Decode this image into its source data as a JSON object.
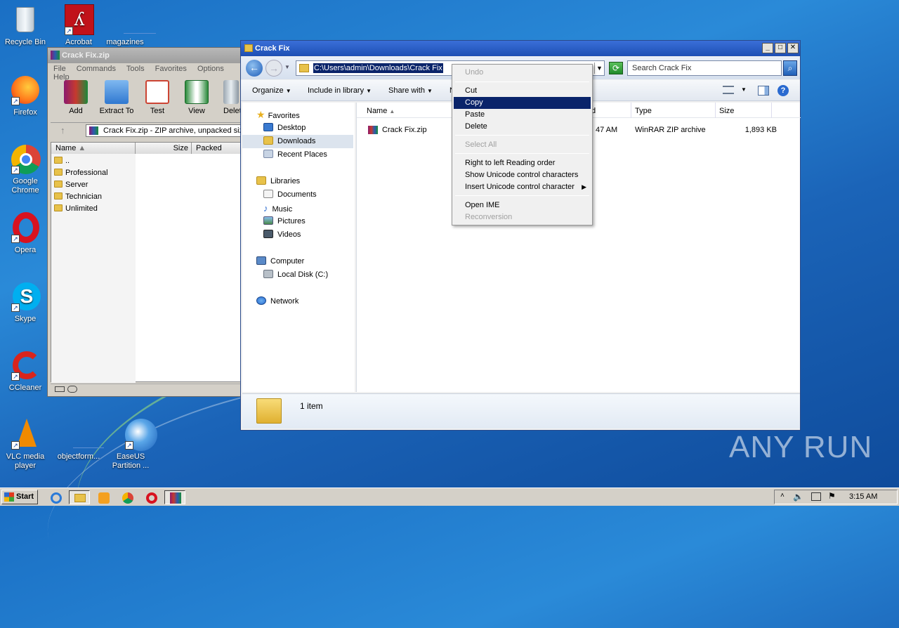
{
  "desktop": {
    "icons": [
      {
        "label": "Recycle Bin",
        "icon": "recycle-bin-icon"
      },
      {
        "label": "Acrobat",
        "icon": "acrobat-icon"
      },
      {
        "label": "magazines",
        "icon": "file-icon"
      },
      {
        "label": "Firefox",
        "icon": "firefox-icon"
      },
      {
        "label": "Google Chrome",
        "icon": "chrome-icon"
      },
      {
        "label": "Opera",
        "icon": "opera-icon"
      },
      {
        "label": "Skype",
        "icon": "skype-icon"
      },
      {
        "label": "CCleaner",
        "icon": "ccleaner-icon"
      },
      {
        "label": "VLC media player",
        "icon": "vlc-icon"
      },
      {
        "label": "objectform...",
        "icon": "file-icon"
      },
      {
        "label": "EaseUS Partition ...",
        "icon": "easeus-icon"
      }
    ],
    "watermark": "ANY RUN"
  },
  "winrar": {
    "title": "Crack Fix.zip",
    "menu": [
      "File",
      "Commands",
      "Tools",
      "Favorites",
      "Options",
      "Help"
    ],
    "toolbar": [
      "Add",
      "Extract To",
      "Test",
      "View",
      "Delet"
    ],
    "path": "Crack Fix.zip - ZIP archive, unpacked size",
    "columns": [
      "Name",
      "Size",
      "Packed"
    ],
    "rows": [
      "..",
      "Professional",
      "Server",
      "Technician",
      "Unlimited"
    ]
  },
  "explorer": {
    "title": "Crack Fix",
    "address": "C:\\Users\\admin\\Downloads\\Crack Fix",
    "search_placeholder": "Search Crack Fix",
    "commands": [
      "Organize",
      "Include in library",
      "Share with",
      "N"
    ],
    "nav": {
      "favorites": "Favorites",
      "desktop": "Desktop",
      "downloads": "Downloads",
      "recent": "Recent Places",
      "libraries": "Libraries",
      "documents": "Documents",
      "music": "Music",
      "pictures": "Pictures",
      "videos": "Videos",
      "computer": "Computer",
      "localdisk": "Local Disk (C:)",
      "network": "Network"
    },
    "columns": {
      "name": "Name",
      "date_fragment": "d",
      "type": "Type",
      "size": "Size"
    },
    "file": {
      "name": "Crack Fix.zip",
      "date_fragment": "47 AM",
      "type": "WinRAR ZIP archive",
      "size": "1,893 KB"
    },
    "status": "1 item"
  },
  "context_menu": {
    "undo": "Undo",
    "cut": "Cut",
    "copy": "Copy",
    "paste": "Paste",
    "delete": "Delete",
    "select_all": "Select All",
    "rtl": "Right to left Reading order",
    "show_unicode": "Show Unicode control characters",
    "insert_unicode": "Insert Unicode control character",
    "open_ime": "Open IME",
    "reconversion": "Reconversion"
  },
  "taskbar": {
    "start": "Start",
    "clock": "3:15 AM"
  },
  "colors": {
    "title_active": "#1d4fb4",
    "selection": "#0a246a",
    "desktop": "#1a6fc4"
  }
}
